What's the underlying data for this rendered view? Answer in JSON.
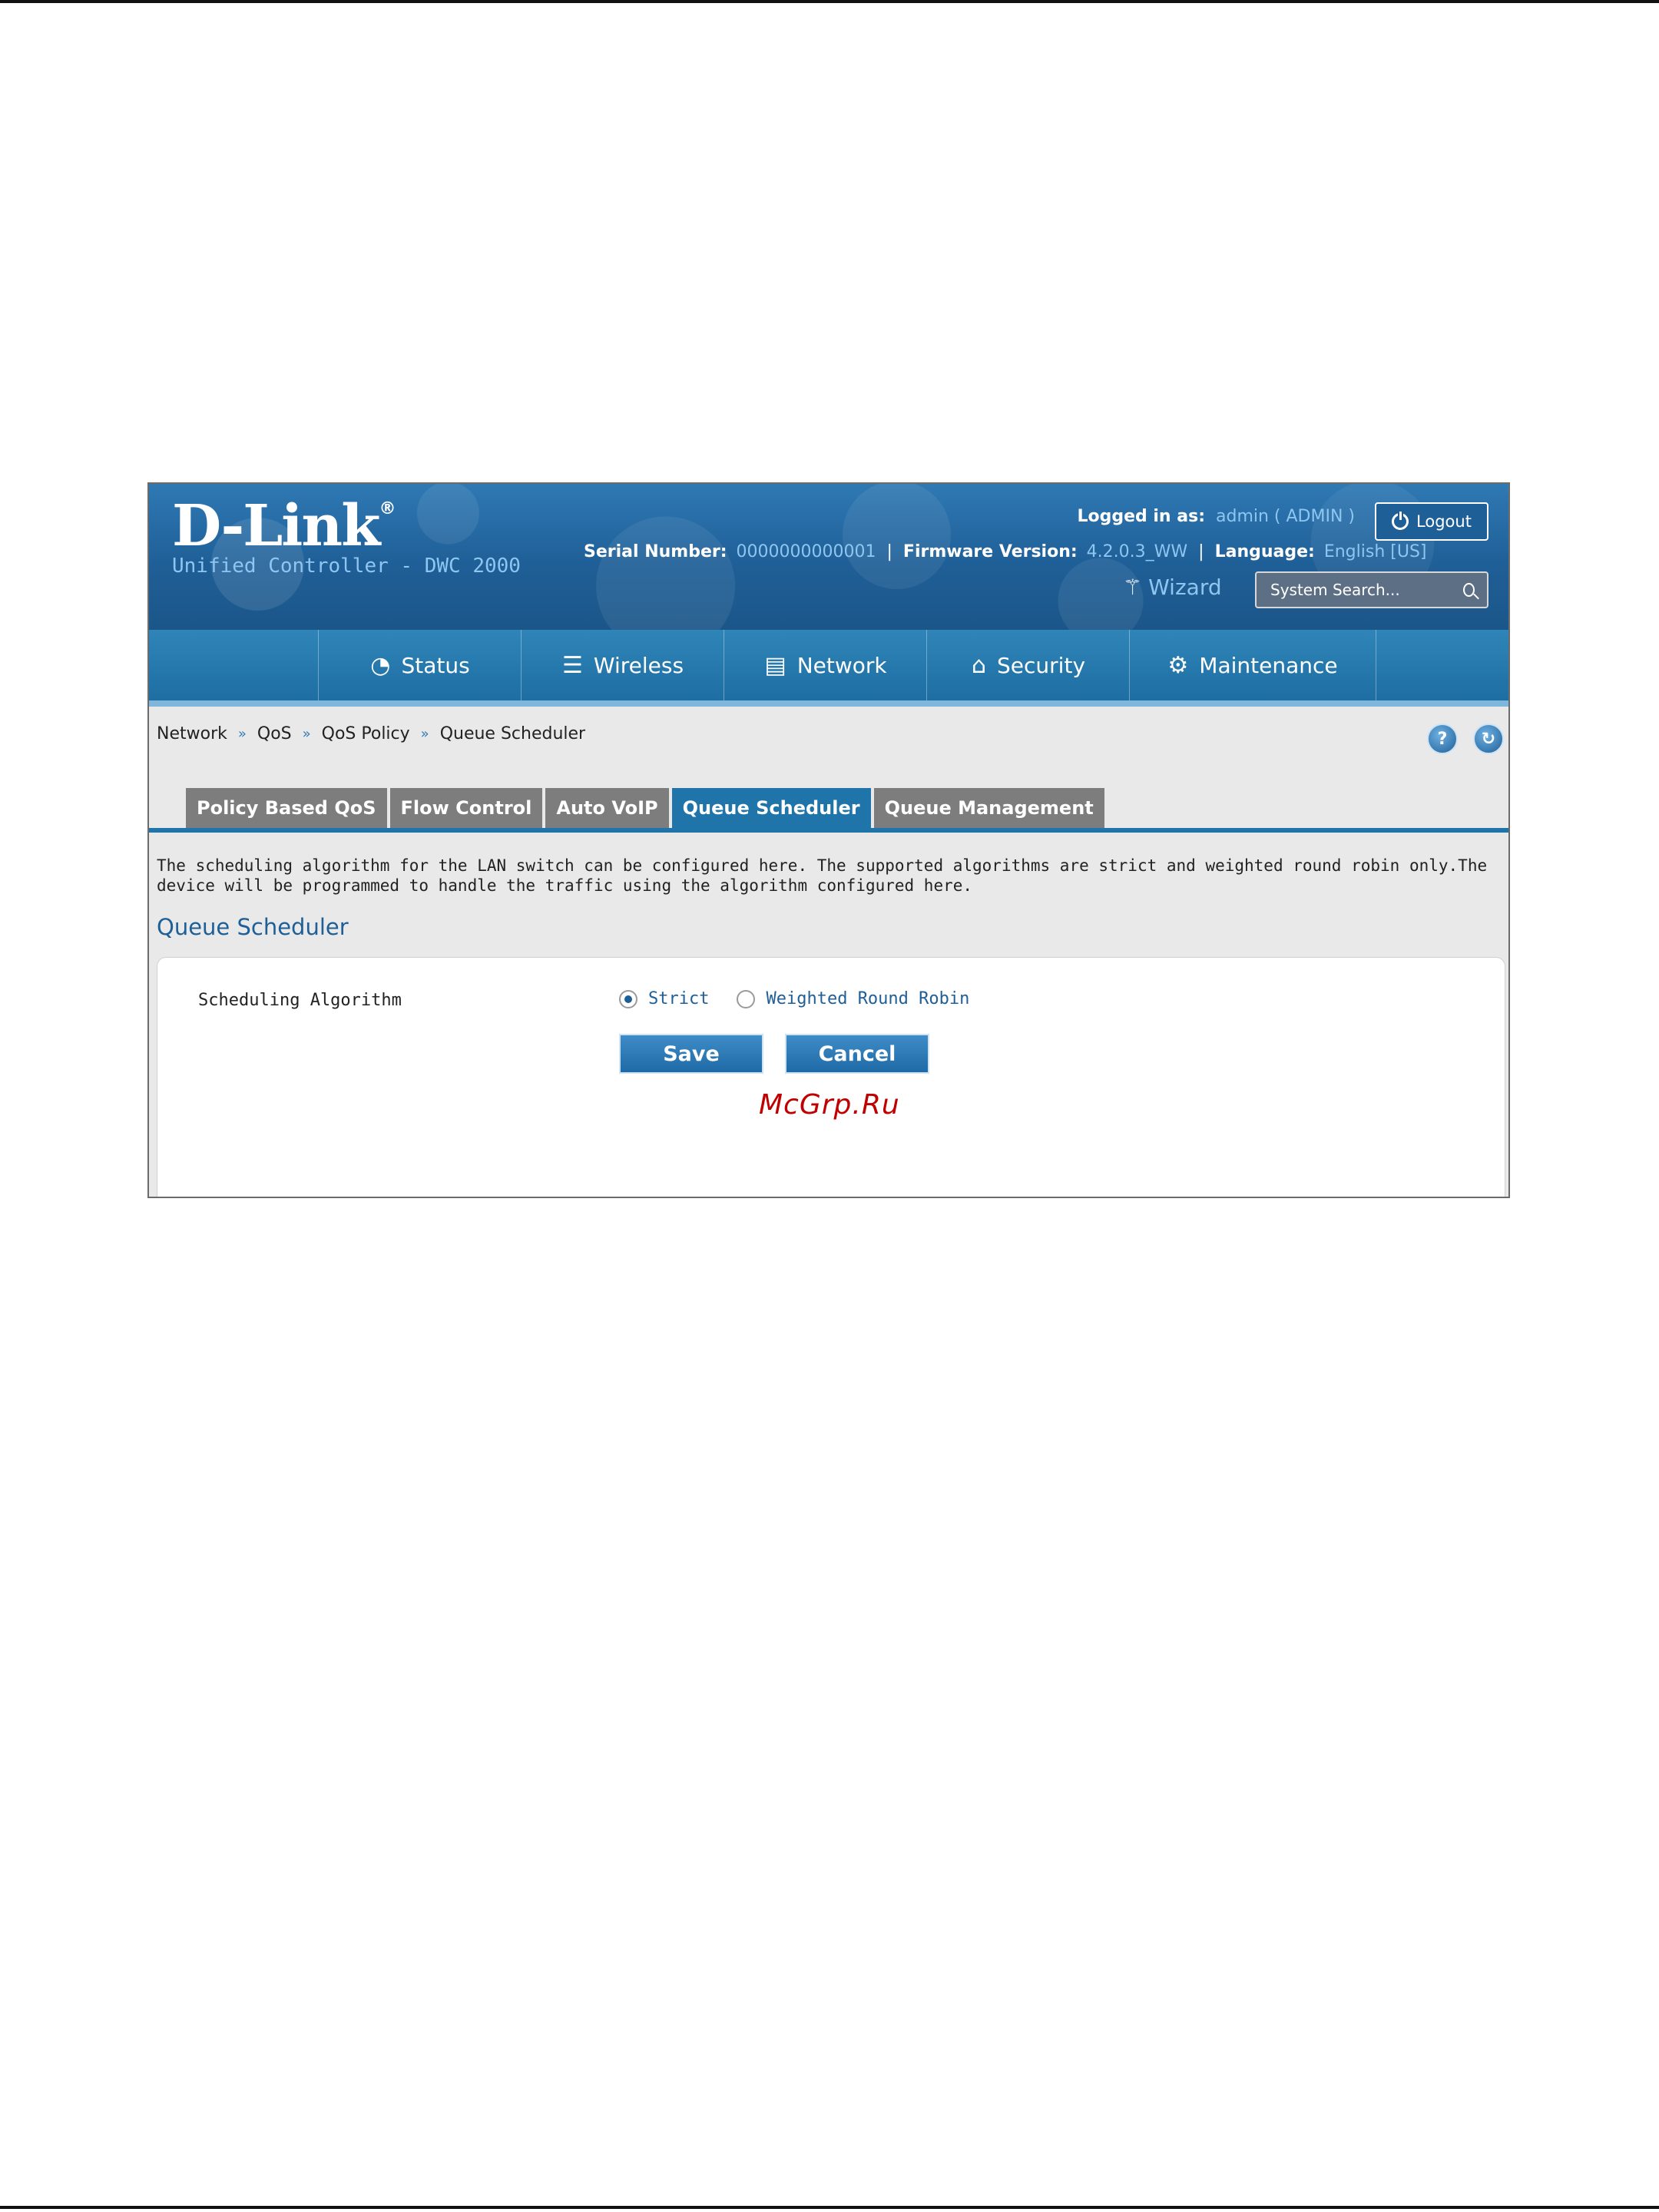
{
  "header": {
    "logo": "D-Link",
    "logo_mark": "®",
    "product": "Unified Controller - DWC 2000",
    "logged_in_label": "Logged in as:",
    "logged_in_value": "admin ( ADMIN )",
    "logout_label": "Logout",
    "serial_label": "Serial Number:",
    "serial_value": "0000000000001",
    "firmware_label": "Firmware Version:",
    "firmware_value": "4.2.0.3_WW",
    "language_label": "Language:",
    "language_value": "English [US]",
    "wizard_label": "Wizard",
    "search_placeholder": "System Search..."
  },
  "nav": {
    "items": [
      {
        "label": "Status",
        "icon": "gauge-icon"
      },
      {
        "label": "Wireless",
        "icon": "wifi-icon"
      },
      {
        "label": "Network",
        "icon": "computer-icon"
      },
      {
        "label": "Security",
        "icon": "lock-icon"
      },
      {
        "label": "Maintenance",
        "icon": "gear-icon"
      }
    ]
  },
  "breadcrumb": [
    "Network",
    "QoS",
    "QoS Policy",
    "Queue Scheduler"
  ],
  "breadcrumb_sep": "»",
  "help_label": "?",
  "refresh_label": "↻",
  "tabs": [
    {
      "label": "Policy Based QoS",
      "active": false
    },
    {
      "label": "Flow Control",
      "active": false
    },
    {
      "label": "Auto VoIP",
      "active": false
    },
    {
      "label": "Queue Scheduler",
      "active": true
    },
    {
      "label": "Queue Management",
      "active": false
    }
  ],
  "description": "The scheduling algorithm for the LAN switch can be configured here. The supported algorithms are strict and weighted round robin only.The device will be programmed to handle the traffic using the algorithm configured here.",
  "section_title": "Queue Scheduler",
  "form": {
    "field_label": "Scheduling Algorithm",
    "options": [
      {
        "label": "Strict",
        "checked": true
      },
      {
        "label": "Weighted Round Robin",
        "checked": false
      }
    ],
    "save_label": "Save",
    "cancel_label": "Cancel"
  },
  "watermark": "McGrp.Ru",
  "colors": {
    "brand_blue": "#1f5f97",
    "active_tab": "#1f74aa",
    "inactive_tab": "#7d7d7d",
    "link_blue": "#8ec6f0"
  }
}
